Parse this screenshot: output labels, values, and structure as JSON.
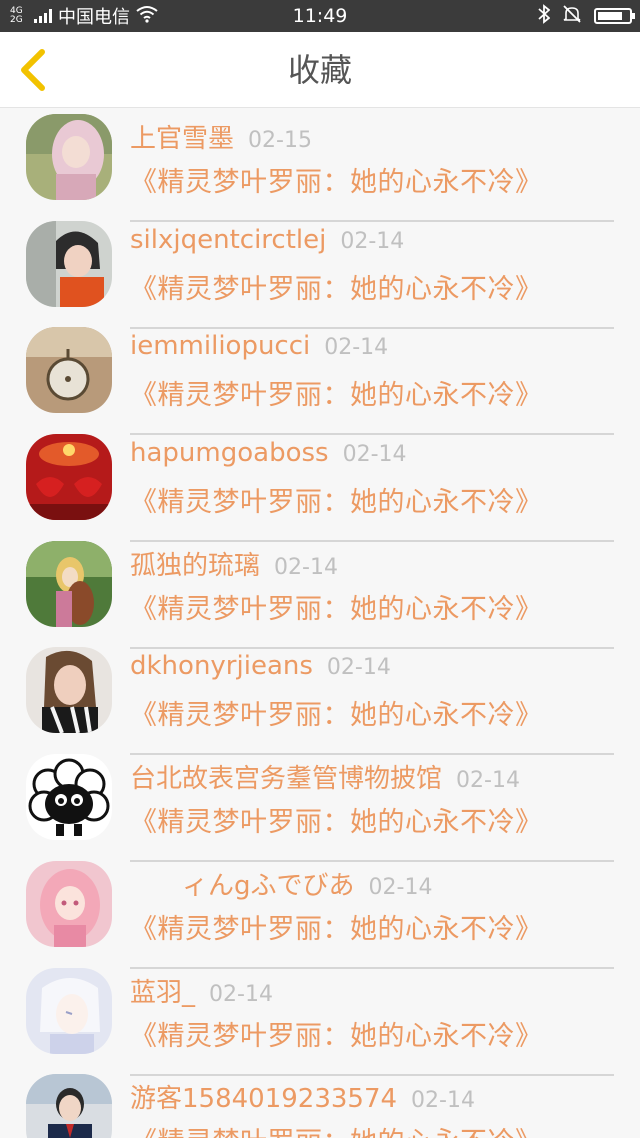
{
  "status_bar": {
    "network": "4G 2G",
    "carrier": "中国电信",
    "time": "11:49"
  },
  "header": {
    "title": "收藏"
  },
  "items": [
    {
      "username": "上官雪墨",
      "date": "02-15",
      "title": "《精灵梦叶罗丽：她的心永不冷》"
    },
    {
      "username": "silxjqentcirctlej",
      "date": "02-14",
      "title": "《精灵梦叶罗丽：她的心永不冷》"
    },
    {
      "username": "iemmiliopucci",
      "date": "02-14",
      "title": "《精灵梦叶罗丽：她的心永不冷》"
    },
    {
      "username": "hapumgoaboss",
      "date": "02-14",
      "title": "《精灵梦叶罗丽：她的心永不冷》"
    },
    {
      "username": "孤独的琉璃",
      "date": "02-14",
      "title": "《精灵梦叶罗丽：她的心永不冷》"
    },
    {
      "username": "dkhonyrjieans",
      "date": "02-14",
      "title": "《精灵梦叶罗丽：她的心永不冷》"
    },
    {
      "username": "台北故表宫务耋管博物披馆",
      "date": "02-14",
      "title": "《精灵梦叶罗丽：她的心永不冷》"
    },
    {
      "username": "　　ィんgふでびあ",
      "date": "02-14",
      "title": "《精灵梦叶罗丽：她的心永不冷》"
    },
    {
      "username": "蓝羽_",
      "date": "02-14",
      "title": "《精灵梦叶罗丽：她的心永不冷》"
    },
    {
      "username": "游客1584019233574",
      "date": "02-14",
      "title": "《精灵梦叶罗丽：她的心永不冷》"
    }
  ],
  "colors": {
    "accent": "#ec9a63",
    "back_arrow": "#f2c200",
    "status_bar": "#3b3b3b"
  },
  "icons": {
    "back": "chevron-left-icon",
    "bluetooth": "bluetooth-icon",
    "mute": "bell-muted-icon",
    "battery": "battery-icon",
    "wifi": "wifi-icon"
  },
  "battery_level": 0.8
}
